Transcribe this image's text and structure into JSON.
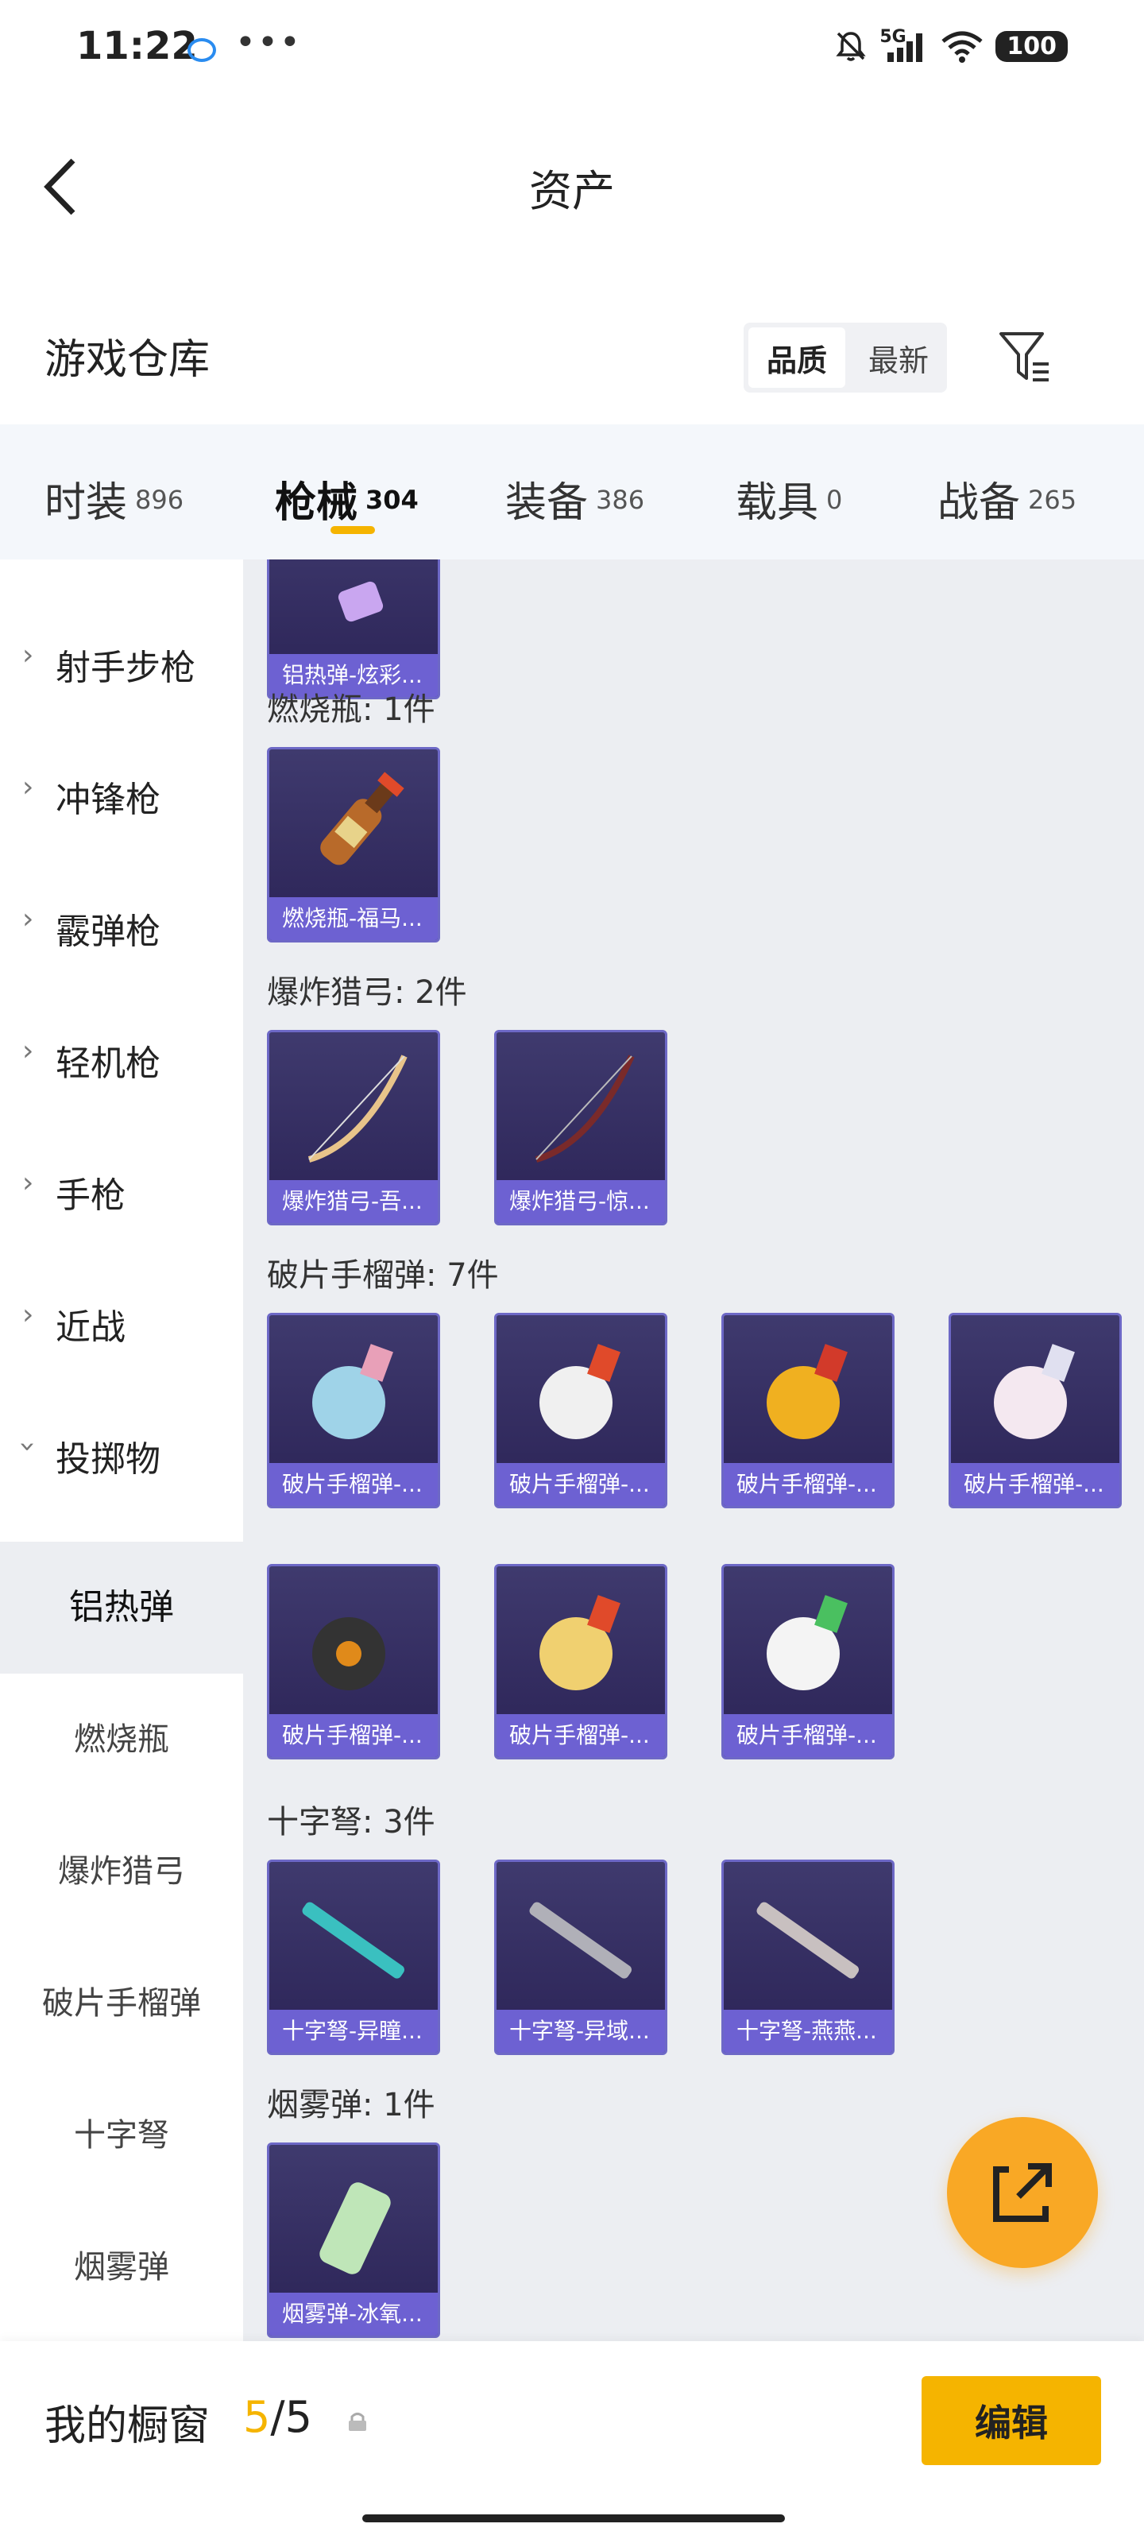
{
  "status_bar": {
    "time": "11:22",
    "network": "5G",
    "battery": "100",
    "more": "•••"
  },
  "header": {
    "title": "资产"
  },
  "warehouse": {
    "title": "游戏仓库",
    "sort_options": [
      "品质",
      "最新"
    ],
    "active_sort": "品质"
  },
  "tabs": [
    {
      "label": "时装",
      "count": "896"
    },
    {
      "label": "枪械",
      "count": "304",
      "active": true
    },
    {
      "label": "装备",
      "count": "386"
    },
    {
      "label": "载具",
      "count": "0"
    },
    {
      "label": "战备",
      "count": "265"
    }
  ],
  "sidebar": {
    "categories": [
      "射手步枪",
      "冲锋枪",
      "霰弹枪",
      "轻机枪",
      "手枪",
      "近战",
      "投掷物"
    ],
    "subcategories": [
      "铝热弹",
      "燃烧瓶",
      "爆炸猎弓",
      "破片手榴弹",
      "十字弩",
      "烟雾弹"
    ],
    "selected": "铝热弹"
  },
  "content": {
    "top_item_label": "铝热弹-炫彩...",
    "groups": [
      {
        "header": "燃烧瓶: 1件",
        "items": [
          "燃烧瓶-福马..."
        ]
      },
      {
        "header": "爆炸猎弓: 2件",
        "items": [
          "爆炸猎弓-吾...",
          "爆炸猎弓-惊..."
        ]
      },
      {
        "header": "破片手榴弹: 7件",
        "items": [
          "破片手榴弹-...",
          "破片手榴弹-...",
          "破片手榴弹-...",
          "破片手榴弹-...",
          "破片手榴弹-...",
          "破片手榴弹-...",
          "破片手榴弹-..."
        ]
      },
      {
        "header": "十字弩: 3件",
        "items": [
          "十字弩-异瞳...",
          "十字弩-异域...",
          "十字弩-燕燕..."
        ]
      },
      {
        "header": "烟雾弹: 1件",
        "items": [
          "烟雾弹-冰氧..."
        ]
      }
    ]
  },
  "bottom_bar": {
    "title": "我的橱窗",
    "count_current": "5",
    "count_sep": "/",
    "count_total": "5",
    "edit_label": "编辑"
  },
  "colors": {
    "accent": "#f5b400",
    "card_bg": "#2b2356",
    "card_label": "#6d61d2"
  }
}
